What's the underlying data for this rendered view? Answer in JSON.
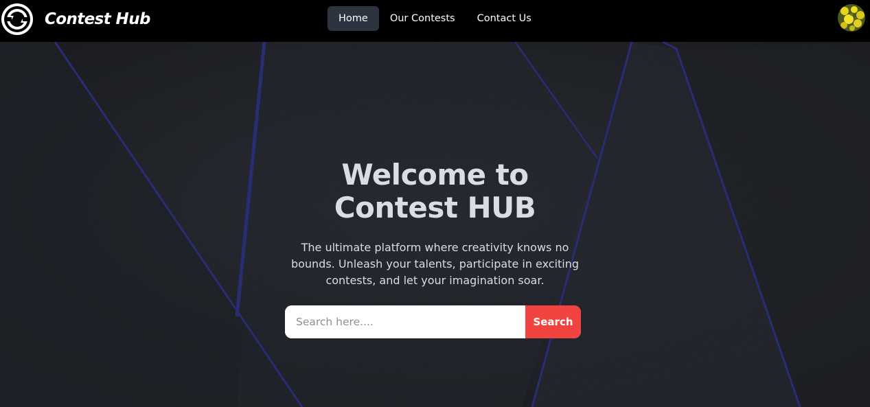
{
  "navbar": {
    "brand": {
      "name": "Contest Hub",
      "logo_icon": "refresh-circle-icon"
    },
    "links": [
      {
        "label": "Home",
        "active": true
      },
      {
        "label": "Our Contests",
        "active": false
      },
      {
        "label": "Contact Us",
        "active": false
      }
    ],
    "avatar_icon": "user-avatar-yellow-flowers"
  },
  "hero": {
    "title": "Welcome to Contest HUB",
    "description": "The ultimate platform where creativity knows no bounds. Unleash your talents, participate in exciting contests, and let your imagination soar.",
    "search": {
      "placeholder": "Search here....",
      "button_label": "Search"
    }
  },
  "colors": {
    "navbar_bg": "#000000",
    "hero_bg": "#23262d",
    "accent_lines": "#2a2f7a",
    "search_button": "#f1433f",
    "active_tab": "#2d3440"
  }
}
